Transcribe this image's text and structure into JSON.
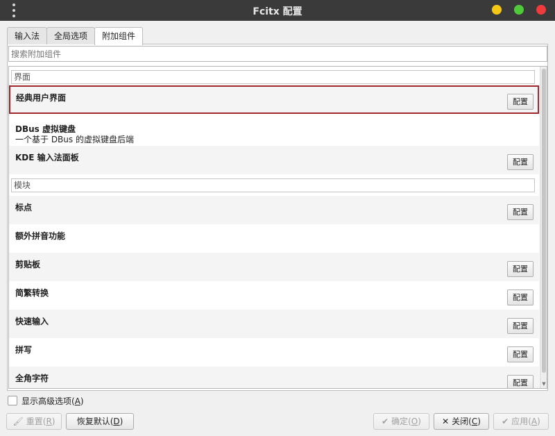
{
  "window": {
    "title": "Fcitx 配置"
  },
  "tabs": [
    {
      "label": "输入法"
    },
    {
      "label": "全局选项"
    },
    {
      "label": "附加组件"
    }
  ],
  "search": {
    "placeholder": "搜索附加组件"
  },
  "groups": [
    {
      "label": "界面"
    },
    {
      "label": "模块"
    }
  ],
  "addons": [
    {
      "title": "经典用户界面",
      "desc": "",
      "button": "配置"
    },
    {
      "title": "DBus 虚拟键盘",
      "desc": "一个基于 DBus 的虚拟键盘后端",
      "button": ""
    },
    {
      "title": "KDE 输入法面板",
      "desc": "",
      "button": "配置"
    },
    {
      "title": "标点",
      "desc": "",
      "button": "配置"
    },
    {
      "title": "额外拼音功能",
      "desc": "",
      "button": ""
    },
    {
      "title": "剪贴板",
      "desc": "",
      "button": "配置"
    },
    {
      "title": "简繁转换",
      "desc": "",
      "button": "配置"
    },
    {
      "title": "快速输入",
      "desc": "",
      "button": "配置"
    },
    {
      "title": "拼写",
      "desc": "",
      "button": "配置"
    },
    {
      "title": "全角字符",
      "desc": "",
      "button": "配置"
    }
  ],
  "advanced": {
    "label": "显示高级选项(",
    "mnemonic": "A",
    "suffix": ")"
  },
  "buttons": {
    "reset": {
      "label": "重置(",
      "mnemonic": "R",
      "suffix": ")"
    },
    "restore": {
      "label": "恢复默认(",
      "mnemonic": "D",
      "suffix": ")"
    },
    "ok": {
      "label": "确定(",
      "mnemonic": "O",
      "suffix": ")"
    },
    "close": {
      "label": "关闭(",
      "mnemonic": "C",
      "suffix": ")"
    },
    "apply": {
      "label": "应用(",
      "mnemonic": "A",
      "suffix": ")"
    }
  },
  "icons": {
    "menu": "menu-dots-icon",
    "brush": "brush-icon",
    "ok": "check-icon",
    "close": "x-icon",
    "apply": "check-icon"
  },
  "colors": {
    "titlebar": "#3a3a3a",
    "minimize": "#f5c814",
    "maximize": "#4fcb3a",
    "close": "#ef3b3b",
    "selection_border": "#a0252c"
  }
}
